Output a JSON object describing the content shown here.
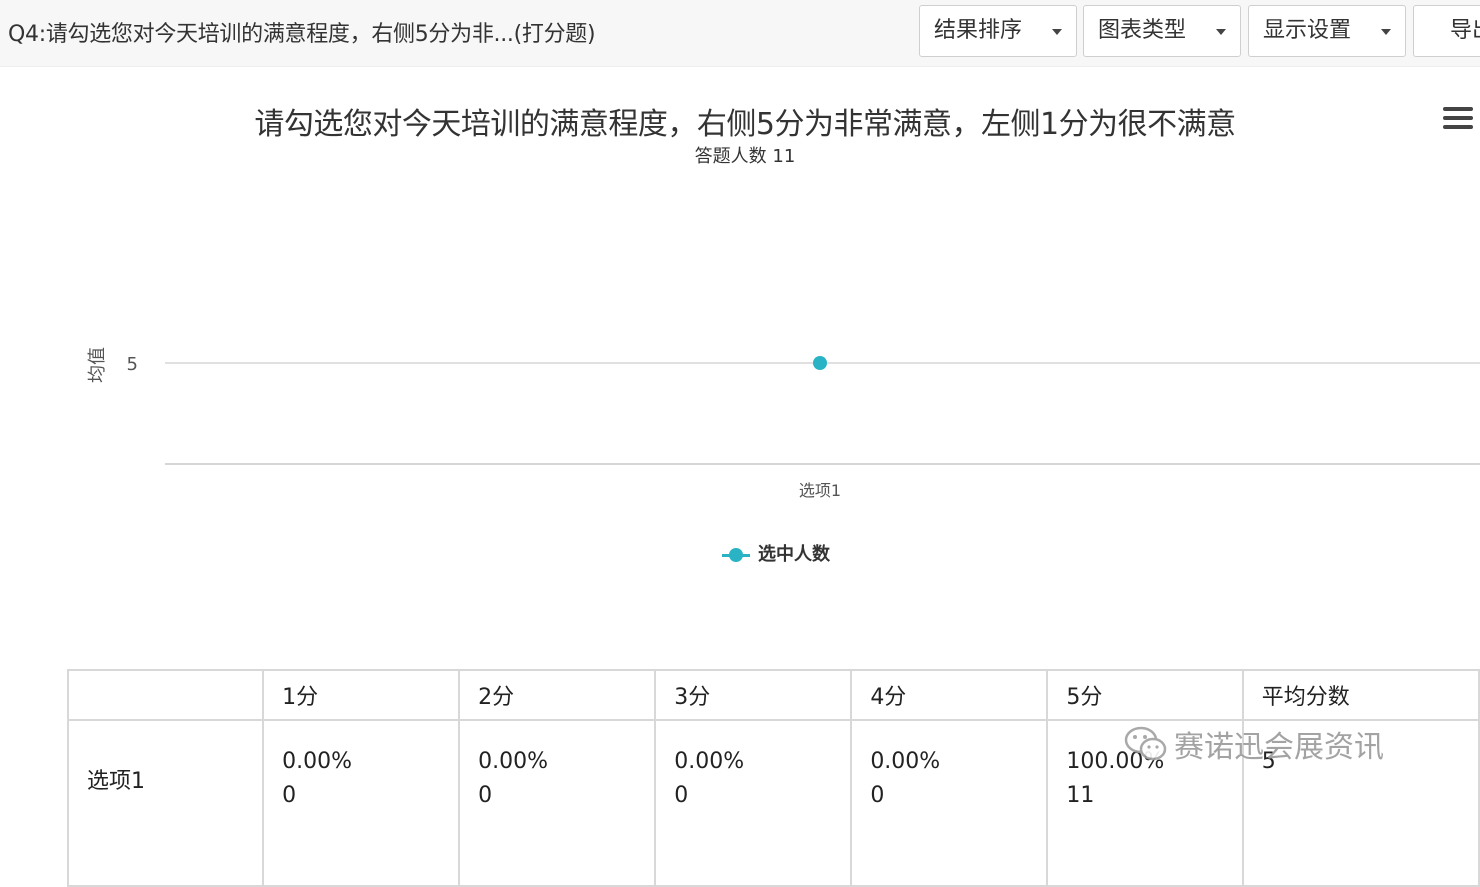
{
  "header": {
    "question_title": "Q4:请勾选您对今天培训的满意程度，右侧5分为非...(打分题)",
    "buttons": [
      {
        "label": "结果排序"
      },
      {
        "label": "图表类型"
      },
      {
        "label": "显示设置"
      },
      {
        "label": "导出"
      }
    ]
  },
  "chart_data": {
    "type": "line",
    "title": "请勾选您对今天培训的满意程度，右侧5分为非常满意，左侧1分为很不满意",
    "subtitle": "答题人数 11",
    "ylabel": "均值",
    "categories": [
      "选项1"
    ],
    "yticks": [
      "5"
    ],
    "series": [
      {
        "name": "选中人数",
        "values": [
          5
        ],
        "color": "#2ab3c4"
      }
    ],
    "grid": true,
    "legend_position": "bottom"
  },
  "table": {
    "headers": [
      "",
      "1分",
      "2分",
      "3分",
      "4分",
      "5分",
      "平均分数"
    ],
    "rows": [
      {
        "label": "选项1",
        "cells": [
          {
            "pct": "0.00%",
            "count": "0"
          },
          {
            "pct": "0.00%",
            "count": "0"
          },
          {
            "pct": "0.00%",
            "count": "0"
          },
          {
            "pct": "0.00%",
            "count": "0"
          },
          {
            "pct": "100.00%",
            "count": "11"
          }
        ],
        "average": "5"
      }
    ]
  },
  "watermark": {
    "text": "赛诺迅会展资讯",
    "icon": "wechat-icon"
  }
}
